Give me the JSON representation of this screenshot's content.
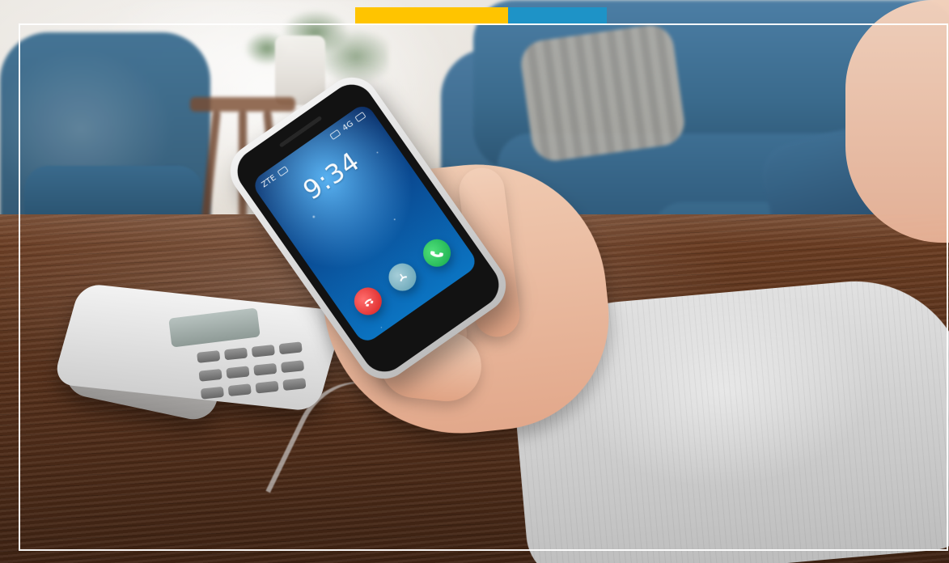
{
  "phone_screen": {
    "time": "9:34",
    "status_left": "ZTE",
    "status_right": "4G"
  },
  "colors": {
    "accent_yellow": "#ffc400",
    "accent_blue": "#1e93c7",
    "frame": "#ffffff"
  },
  "call_buttons": {
    "decline_icon": "phone-down-icon",
    "middle_icon": "phone-hold-icon",
    "accept_icon": "phone-up-icon"
  }
}
